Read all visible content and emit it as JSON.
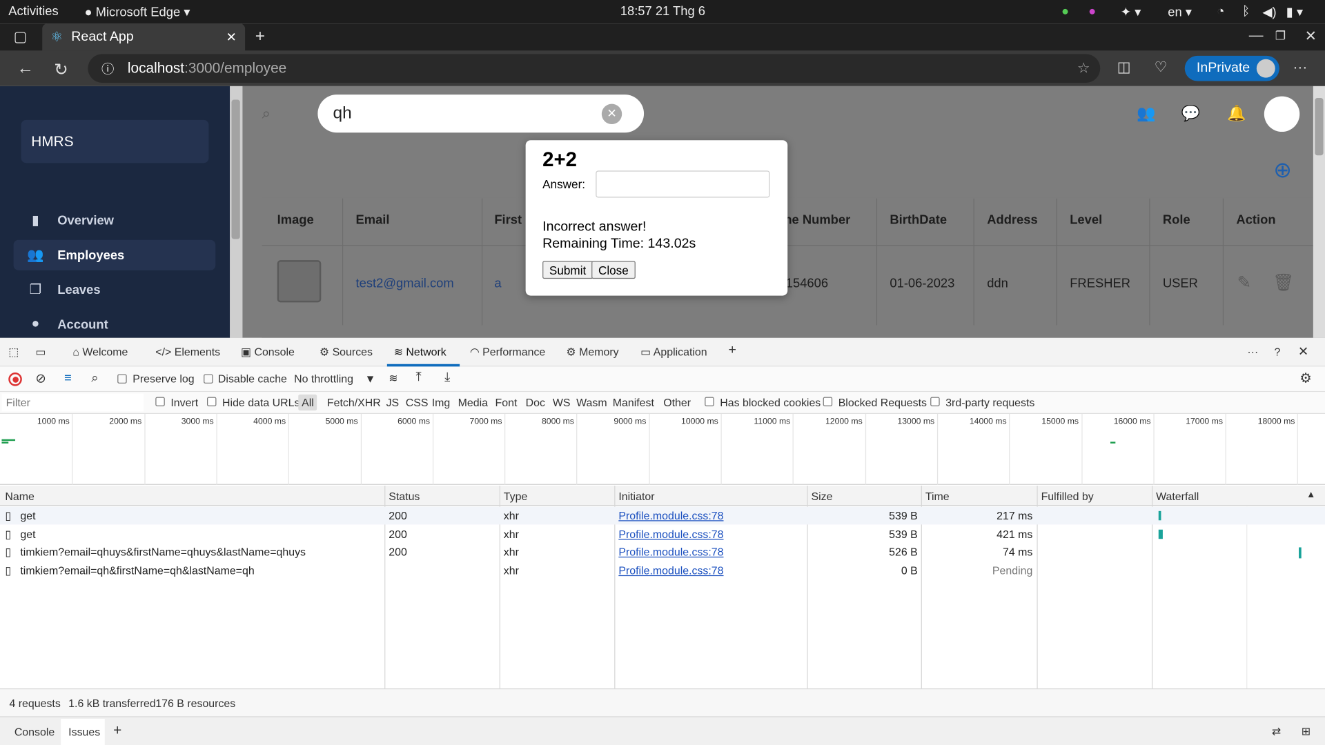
{
  "system": {
    "activities": "Activities",
    "app_name": "Microsoft Edge",
    "clock": "18:57  21 Thg 6",
    "lang": "en"
  },
  "browser": {
    "tab_title": "React App",
    "url_host": "localhost",
    "url_path": ":3000/employee",
    "inprivate": "InPrivate"
  },
  "app": {
    "brand": "HMRS",
    "nav": [
      {
        "label": "Overview",
        "icon": "chart-icon"
      },
      {
        "label": "Employees",
        "icon": "users-icon"
      },
      {
        "label": "Leaves",
        "icon": "document-icon"
      },
      {
        "label": "Account",
        "icon": "person-icon"
      }
    ],
    "search_value": "qh",
    "table_headers": [
      "Image",
      "Email",
      "First",
      "ne Number",
      "BirthDate",
      "Address",
      "Level",
      "Role",
      "Action"
    ],
    "row": {
      "email": "test2@gmail.com",
      "first": "a",
      "phone": "154606",
      "birthdate": "01-06-2023",
      "address": "ddn",
      "level": "FRESHER",
      "role": "USER"
    }
  },
  "modal": {
    "question": "2+2",
    "answer_label": "Answer:",
    "answer_value": "",
    "message": "Incorrect answer!",
    "remaining": "Remaining Time: 143.02s",
    "submit": "Submit",
    "close": "Close"
  },
  "devtools": {
    "tabs": [
      "Welcome",
      "Elements",
      "Console",
      "Sources",
      "Network",
      "Performance",
      "Memory",
      "Application"
    ],
    "active_tab": "Network",
    "preserve_log": "Preserve log",
    "disable_cache": "Disable cache",
    "throttling": "No throttling",
    "filter_placeholder": "Filter",
    "invert": "Invert",
    "hide_data_urls": "Hide data URLs",
    "types": [
      "All",
      "Fetch/XHR",
      "JS",
      "CSS",
      "Img",
      "Media",
      "Font",
      "Doc",
      "WS",
      "Wasm",
      "Manifest",
      "Other"
    ],
    "has_blocked_cookies": "Has blocked cookies",
    "blocked_requests": "Blocked Requests",
    "third_party": "3rd-party requests",
    "timeline_ticks": [
      "1000 ms",
      "2000 ms",
      "3000 ms",
      "4000 ms",
      "5000 ms",
      "6000 ms",
      "7000 ms",
      "8000 ms",
      "9000 ms",
      "10000 ms",
      "11000 ms",
      "12000 ms",
      "13000 ms",
      "14000 ms",
      "15000 ms",
      "16000 ms",
      "17000 ms",
      "18000 ms"
    ],
    "columns": [
      "Name",
      "Status",
      "Type",
      "Initiator",
      "Size",
      "Time",
      "Fulfilled by",
      "Waterfall"
    ],
    "requests": [
      {
        "name": "get",
        "status": "200",
        "type": "xhr",
        "initiator": "Profile.module.css:78",
        "size": "539 B",
        "time": "217 ms"
      },
      {
        "name": "get",
        "status": "200",
        "type": "xhr",
        "initiator": "Profile.module.css:78",
        "size": "539 B",
        "time": "421 ms"
      },
      {
        "name": "timkiem?email=qhuys&firstName=qhuys&lastName=qhuys",
        "status": "200",
        "type": "xhr",
        "initiator": "Profile.module.css:78",
        "size": "526 B",
        "time": "74 ms"
      },
      {
        "name": "timkiem?email=qh&firstName=qh&lastName=qh",
        "status": "",
        "type": "xhr",
        "initiator": "Profile.module.css:78",
        "size": "0 B",
        "time": "Pending"
      }
    ],
    "summary": {
      "requests": "4 requests",
      "transferred": "1.6 kB transferred",
      "resources": "176 B resources"
    },
    "drawer_tabs": [
      "Console",
      "Issues"
    ]
  }
}
